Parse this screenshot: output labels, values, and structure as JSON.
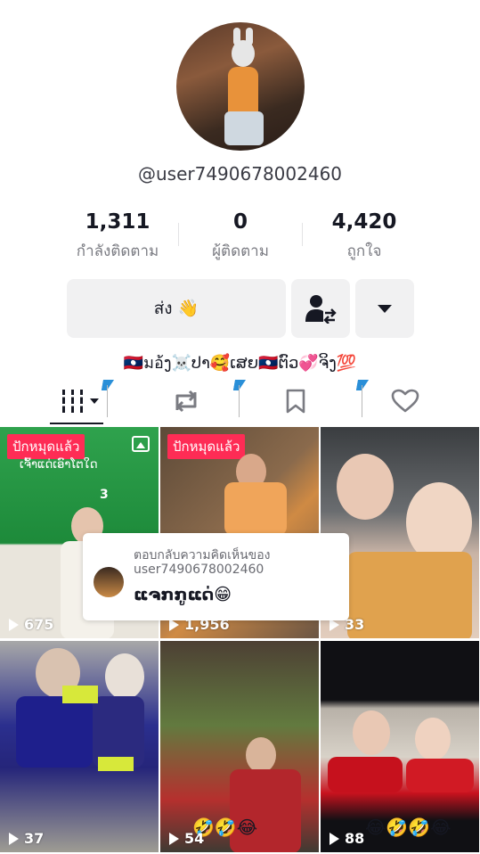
{
  "profile": {
    "username": "@user7490678002460",
    "stats": [
      {
        "value": "1,311",
        "label": "กำลังติดตาม"
      },
      {
        "value": "0",
        "label": "ผู้ติดตาม"
      },
      {
        "value": "4,420",
        "label": "ถูกใจ"
      }
    ],
    "send_button": "ส่ง 👋",
    "bio": "🇱🇦มอ้ງ☠️ປາ🥰ເສຍ🇱🇦ຕົວ💞ຈິງ💯"
  },
  "tabs": [
    {
      "name": "videos",
      "icon": "grid-icon"
    },
    {
      "name": "reposts",
      "icon": "repost-icon"
    },
    {
      "name": "favorites",
      "icon": "bookmark-icon"
    },
    {
      "name": "liked",
      "icon": "heart-icon"
    }
  ],
  "videos": [
    {
      "tag": "ปักหมุดแล้ว",
      "subtitle": "ເຈົ້າແດ່ເອົາໂຕໃດ",
      "overlay_number": "3",
      "plays": "675"
    },
    {
      "tag": "ปักหมุดแล้ว",
      "plays": "1,956"
    },
    {
      "plays": "33"
    },
    {
      "plays": "37"
    },
    {
      "plays": "54",
      "emojis": "🤣🤣😂"
    },
    {
      "plays": "88",
      "emojis": "😂🤣🤣😂"
    }
  ],
  "reply_card": {
    "line1": "ตอบกลับความคิดเห็นของ",
    "line2": "user7490678002460",
    "comment": "ແຈກກູແດ່😁"
  },
  "colors": {
    "accent": "#fe2c55",
    "pin": "#2a8fd8"
  }
}
